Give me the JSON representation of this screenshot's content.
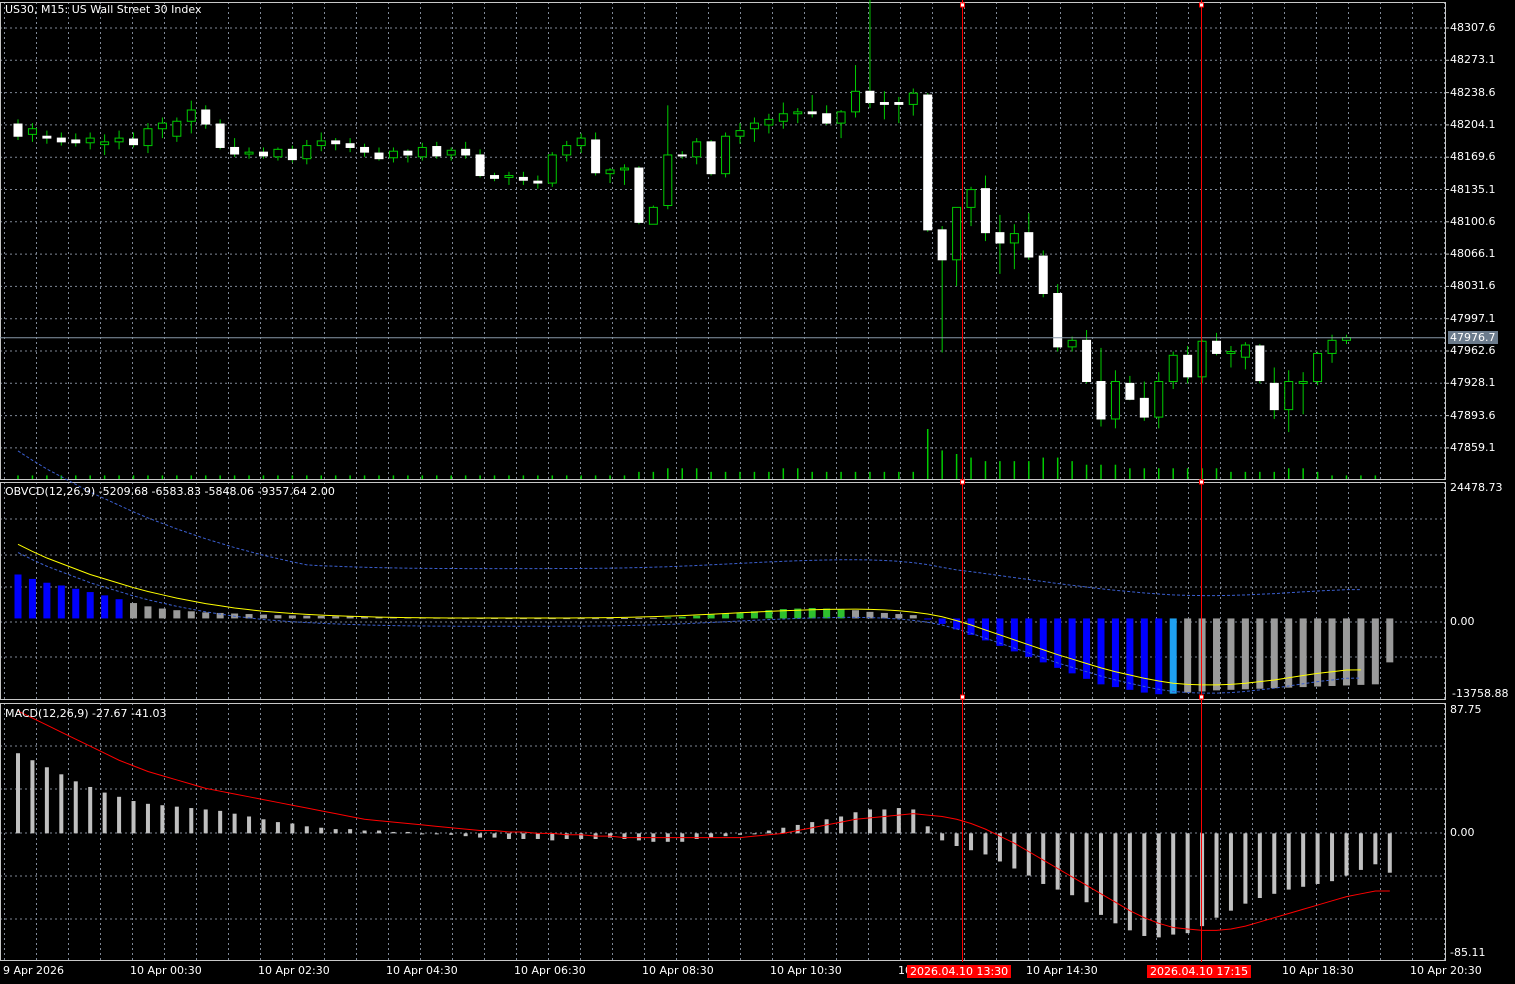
{
  "header": {
    "main_title": "US30, M15:  US Wall Street 30 Index",
    "obvcd_title": "OBVCD(12,26,9) -5209.68 -6583.83 -5848.06 -9357.64 2.00",
    "macd_title": "MACD(12,26,9) -27.67 -41.03"
  },
  "price_axis": {
    "labels": [
      "48307.6",
      "48273.1",
      "48238.6",
      "48204.1",
      "48169.6",
      "48135.1",
      "48100.6",
      "48066.1",
      "48031.6",
      "47997.1",
      "47962.6",
      "47928.1",
      "47893.6",
      "47859.1"
    ],
    "current_price": "47976.7"
  },
  "obvcd_axis": {
    "top": "24478.73",
    "zero": "0.00",
    "bottom": "-13758.88"
  },
  "macd_axis": {
    "top": "87.75",
    "zero": "0.00",
    "bottom": "-85.11"
  },
  "time_axis": {
    "labels": [
      "9 Apr 2026",
      "10 Apr 00:30",
      "10 Apr 02:30",
      "10 Apr 04:30",
      "10 Apr 06:30",
      "10 Apr 08:30",
      "10 Apr 10:30",
      "10",
      "10 Apr 14:30",
      "10 Apr 18:30",
      "10 Apr 20:30"
    ],
    "marker_tags": [
      "2026.04.10 13:30",
      "2026.04.10 17:15"
    ]
  },
  "colors": {
    "background": "#000000",
    "grid": "#7f8896",
    "bull": "#000000",
    "bull_outline": "#00cc00",
    "bear": "#ffffff",
    "wick": "#00cc00",
    "volume": "#00cc00",
    "vline": "#ff0000",
    "obvcd_blue": "#0000ff",
    "obvcd_gray": "#9a9a9a",
    "obvcd_green": "#2ec02e",
    "obvcd_cyan": "#1ea0f0",
    "obvcd_signal": "#ffff00",
    "obvcd_band": "#3b5fd0",
    "macd_hist": "#c0c0c0",
    "macd_signal": "#ff0000"
  },
  "chart_data": [
    {
      "type": "candlestick",
      "title": "US30, M15:  US Wall Street 30 Index",
      "ylim": [
        47840,
        48330
      ],
      "x": [
        "9 Apr 2026",
        "10 Apr 00:30",
        "10 Apr 02:30",
        "10 Apr 04:30",
        "10 Apr 06:30",
        "10 Apr 08:30",
        "10 Apr 10:30",
        "10 Apr 14:30",
        "10 Apr 18:30",
        "10 Apr 20:30"
      ],
      "candles": [
        [
          48205,
          48210,
          48188,
          48192
        ],
        [
          48194,
          48206,
          48186,
          48200
        ],
        [
          48192,
          48198,
          48184,
          48190
        ],
        [
          48190,
          48196,
          48182,
          48186
        ],
        [
          48188,
          48195,
          48181,
          48185
        ],
        [
          48185,
          48196,
          48178,
          48190
        ],
        [
          48183,
          48194,
          48172,
          48186
        ],
        [
          48186,
          48198,
          48178,
          48190
        ],
        [
          48189,
          48196,
          48180,
          48183
        ],
        [
          48182,
          48206,
          48174,
          48200
        ],
        [
          48200,
          48212,
          48190,
          48206
        ],
        [
          48192,
          48212,
          48186,
          48208
        ],
        [
          48208,
          48230,
          48195,
          48220
        ],
        [
          48220,
          48225,
          48200,
          48205
        ],
        [
          48205,
          48210,
          48178,
          48180
        ],
        [
          48180,
          48190,
          48170,
          48173
        ],
        [
          48173,
          48180,
          48168,
          48175
        ],
        [
          48175,
          48180,
          48168,
          48171
        ],
        [
          48170,
          48180,
          48166,
          48178
        ],
        [
          48178,
          48182,
          48164,
          48167
        ],
        [
          48168,
          48188,
          48162,
          48182
        ],
        [
          48182,
          48196,
          48176,
          48187
        ],
        [
          48187,
          48190,
          48177,
          48184
        ],
        [
          48184,
          48190,
          48175,
          48180
        ],
        [
          48180,
          48184,
          48170,
          48175
        ],
        [
          48174,
          48180,
          48166,
          48168
        ],
        [
          48169,
          48180,
          48164,
          48176
        ],
        [
          48176,
          48178,
          48164,
          48172
        ],
        [
          48170,
          48185,
          48166,
          48180
        ],
        [
          48181,
          48186,
          48168,
          48171
        ],
        [
          48172,
          48180,
          48166,
          48177
        ],
        [
          48178,
          48186,
          48168,
          48172
        ],
        [
          48172,
          48178,
          48148,
          48150
        ],
        [
          48150,
          48153,
          48144,
          48147
        ],
        [
          48148,
          48154,
          48140,
          48150
        ],
        [
          48148,
          48154,
          48140,
          48145
        ],
        [
          48144,
          48150,
          48136,
          48142
        ],
        [
          48142,
          48175,
          48138,
          48172
        ],
        [
          48172,
          48187,
          48165,
          48182
        ],
        [
          48182,
          48195,
          48174,
          48190
        ],
        [
          48188,
          48196,
          48150,
          48153
        ],
        [
          48152,
          48158,
          48142,
          48156
        ],
        [
          48156,
          48162,
          48140,
          48158
        ],
        [
          48158,
          48160,
          48098,
          48100
        ],
        [
          48098,
          48118,
          48098,
          48116
        ],
        [
          48118,
          48225,
          48114,
          48172
        ],
        [
          48172,
          48176,
          48168,
          48171
        ],
        [
          48170,
          48190,
          48162,
          48186
        ],
        [
          48186,
          48188,
          48150,
          48152
        ],
        [
          48152,
          48196,
          48148,
          48192
        ],
        [
          48192,
          48206,
          48184,
          48198
        ],
        [
          48200,
          48212,
          48186,
          48206
        ],
        [
          48204,
          48216,
          48195,
          48210
        ],
        [
          48208,
          48228,
          48200,
          48216
        ],
        [
          48216,
          48222,
          48206,
          48218
        ],
        [
          48218,
          48236,
          48212,
          48216
        ],
        [
          48216,
          48225,
          48204,
          48206
        ],
        [
          48206,
          48220,
          48190,
          48218
        ],
        [
          48218,
          48268,
          48212,
          48240
        ],
        [
          48240,
          48340,
          48222,
          48228
        ],
        [
          48228,
          48240,
          48210,
          48226
        ],
        [
          48228,
          48234,
          48206,
          48226
        ],
        [
          48226,
          48243,
          48214,
          48238
        ],
        [
          48236,
          48238,
          48090,
          48092
        ],
        [
          48092,
          48096,
          47961,
          48060
        ],
        [
          48060,
          48116,
          48032,
          48116
        ],
        [
          48116,
          48138,
          48096,
          48135
        ],
        [
          48136,
          48150,
          48080,
          48089
        ],
        [
          48089,
          48108,
          48045,
          48078
        ],
        [
          48078,
          48098,
          48050,
          48088
        ],
        [
          48089,
          48110,
          48060,
          48063
        ],
        [
          48064,
          48070,
          48020,
          48024
        ],
        [
          48024,
          48034,
          47962,
          47967
        ],
        [
          47967,
          47978,
          47962,
          47974
        ],
        [
          47974,
          47985,
          47928,
          47930
        ],
        [
          47930,
          47966,
          47882,
          47890
        ],
        [
          47890,
          47942,
          47880,
          47930
        ],
        [
          47928,
          47936,
          47910,
          47911
        ],
        [
          47912,
          47930,
          47888,
          47892
        ],
        [
          47892,
          47940,
          47880,
          47930
        ],
        [
          47930,
          47962,
          47922,
          47958
        ],
        [
          47958,
          47968,
          47928,
          47935
        ],
        [
          47935,
          47975,
          47928,
          47973
        ],
        [
          47973,
          47982,
          47958,
          47960
        ],
        [
          47960,
          47968,
          47945,
          47962
        ],
        [
          47956,
          47972,
          47943,
          47969
        ],
        [
          47968,
          47970,
          47928,
          47931
        ],
        [
          47928,
          47945,
          47890,
          47900
        ],
        [
          47900,
          47942,
          47876,
          47930
        ],
        [
          47928,
          47940,
          47895,
          47930
        ],
        [
          47930,
          47962,
          47926,
          47960
        ],
        [
          47960,
          47980,
          47950,
          47974
        ],
        [
          47974,
          47980,
          47970,
          47977
        ]
      ],
      "volume": [
        1,
        1,
        1,
        1,
        1,
        1,
        1,
        1,
        1,
        1,
        1,
        1,
        1,
        1,
        1,
        1,
        1,
        1,
        1,
        1,
        1,
        1,
        1,
        1,
        1,
        1,
        1,
        1,
        1,
        1,
        1,
        1,
        1,
        1,
        1,
        1,
        1,
        1,
        1,
        1,
        1,
        1,
        1,
        2,
        2,
        3,
        3,
        3,
        2,
        2,
        2,
        2,
        2,
        3,
        3,
        2,
        2,
        2,
        2,
        2,
        2,
        2,
        2,
        14,
        8,
        7,
        6,
        5,
        5,
        5,
        5,
        6,
        6,
        5,
        4,
        4,
        4,
        3,
        3,
        3,
        3,
        3,
        3,
        3,
        2,
        2,
        2,
        2,
        3,
        3,
        2,
        1,
        1,
        1,
        1
      ]
    },
    {
      "type": "bar",
      "title": "OBVCD(12,26,9) -5209.68 -6583.83 -5848.06 -9357.64 2.00",
      "ylim": [
        -13758.88,
        24478.73
      ],
      "histogram": [
        8000,
        7200,
        6500,
        6000,
        5400,
        4800,
        4200,
        3500,
        2800,
        2200,
        1800,
        1500,
        1300,
        1100,
        1000,
        900,
        800,
        700,
        600,
        550,
        500,
        450,
        400,
        350,
        300,
        250,
        200,
        180,
        160,
        140,
        120,
        100,
        90,
        80,
        70,
        60,
        60,
        60,
        60,
        60,
        60,
        60,
        80,
        100,
        120,
        200,
        300,
        500,
        700,
        900,
        1100,
        1300,
        1500,
        1700,
        1800,
        1900,
        1800,
        1700,
        1500,
        1200,
        1000,
        800,
        600,
        -200,
        -1000,
        -2000,
        -3000,
        -4000,
        -5000,
        -6000,
        -7000,
        -8000,
        -9000,
        -10000,
        -11000,
        -12000,
        -12500,
        -13000,
        -13500,
        -13800,
        -13700,
        -13500,
        -13300,
        -13100,
        -13000,
        -12900,
        -12800,
        -12700,
        -12600,
        -12500,
        -12400,
        -12300,
        -12200,
        -12100,
        -12000,
        -8000
      ],
      "hist_colors": [
        "blue",
        "blue",
        "blue",
        "blue",
        "blue",
        "blue",
        "blue",
        "blue",
        "gray",
        "gray",
        "gray",
        "gray",
        "gray",
        "gray",
        "gray",
        "gray",
        "gray",
        "gray",
        "gray",
        "gray",
        "gray",
        "gray",
        "gray",
        "gray",
        "gray",
        "gray",
        "gray",
        "gray",
        "gray",
        "gray",
        "gray",
        "gray",
        "gray",
        "gray",
        "gray",
        "gray",
        "gray",
        "gray",
        "gray",
        "gray",
        "gray",
        "gray",
        "gray",
        "gray",
        "gray",
        "green",
        "green",
        "green",
        "green",
        "green",
        "green",
        "green",
        "green",
        "green",
        "green",
        "green",
        "green",
        "green",
        "gray",
        "gray",
        "gray",
        "gray",
        "gray",
        "blue",
        "blue",
        "blue",
        "blue",
        "blue",
        "blue",
        "blue",
        "blue",
        "blue",
        "blue",
        "blue",
        "blue",
        "blue",
        "blue",
        "blue",
        "blue",
        "blue",
        "cyan",
        "gray",
        "gray",
        "gray",
        "gray",
        "gray",
        "gray",
        "gray",
        "gray",
        "gray",
        "gray",
        "gray",
        "gray",
        "gray",
        "gray",
        "gray",
        "green"
      ],
      "signal": [
        13500,
        12200,
        11000,
        10000,
        9000,
        8000,
        7200,
        6400,
        5600,
        4900,
        4300,
        3700,
        3200,
        2700,
        2300,
        1900,
        1600,
        1300,
        1100,
        900,
        750,
        600,
        500,
        400,
        320,
        250,
        200,
        150,
        120,
        100,
        90,
        80,
        80,
        80,
        80,
        80,
        80,
        80,
        90,
        100,
        120,
        150,
        200,
        260,
        330,
        420,
        520,
        640,
        770,
        900,
        1030,
        1160,
        1290,
        1400,
        1500,
        1580,
        1640,
        1680,
        1690,
        1650,
        1560,
        1400,
        1150,
        800,
        300,
        -400,
        -1200,
        -2100,
        -3000,
        -3900,
        -4800,
        -5700,
        -6600,
        -7400,
        -8200,
        -9000,
        -9700,
        -10300,
        -10900,
        -11400,
        -11800,
        -12000,
        -12100,
        -12100,
        -12000,
        -11800,
        -11500,
        -11200,
        -10800,
        -10400,
        -10000,
        -9700,
        -9400,
        -9357
      ]
    },
    {
      "type": "bar",
      "title": "MACD(12,26,9) -27.67 -41.03",
      "ylim": [
        -85.11,
        87.75
      ],
      "histogram": [
        57,
        52,
        47,
        42,
        37,
        33,
        29,
        26,
        23,
        21,
        20,
        19,
        18,
        17,
        16,
        14,
        12,
        10,
        8,
        7,
        5,
        4,
        3,
        3,
        2,
        2,
        1,
        1,
        0,
        0,
        -1,
        -2,
        -3,
        -3,
        -4,
        -4,
        -4,
        -5,
        -4,
        -4,
        -4,
        -3,
        -4,
        -5,
        -6,
        -6,
        -6,
        -4,
        -3,
        -2,
        -1,
        0,
        2,
        4,
        6,
        8,
        10,
        12,
        15,
        17,
        17,
        18,
        17,
        5,
        -5,
        -9,
        -12,
        -15,
        -20,
        -25,
        -30,
        -36,
        -40,
        -44,
        -49,
        -58,
        -64,
        -69,
        -73,
        -74,
        -72,
        -71,
        -66,
        -60,
        -55,
        -50,
        -46,
        -43,
        -40,
        -38,
        -36,
        -34,
        -30,
        -26,
        -22,
        -28
      ],
      "signal": [
        87,
        82,
        77,
        72,
        67,
        62,
        57,
        52,
        48,
        44,
        41,
        38,
        35,
        32,
        30,
        28,
        26,
        24,
        22,
        20,
        18,
        16,
        14,
        12,
        10,
        9,
        8,
        7,
        6,
        5,
        4,
        3,
        2,
        2,
        1,
        1,
        0,
        0,
        -1,
        -1,
        -2,
        -2,
        -3,
        -3,
        -3,
        -3,
        -3,
        -3,
        -3,
        -3,
        -3,
        -2,
        -1,
        0,
        2,
        4,
        6,
        8,
        10,
        11,
        12,
        13,
        14,
        13,
        12,
        10,
        7,
        3,
        -2,
        -7,
        -13,
        -19,
        -25,
        -31,
        -37,
        -43,
        -49,
        -55,
        -60,
        -64,
        -67,
        -68,
        -69,
        -69,
        -68,
        -66,
        -63,
        -60,
        -57,
        -54,
        -51,
        -48,
        -45,
        -43,
        -41,
        -41
      ]
    }
  ]
}
